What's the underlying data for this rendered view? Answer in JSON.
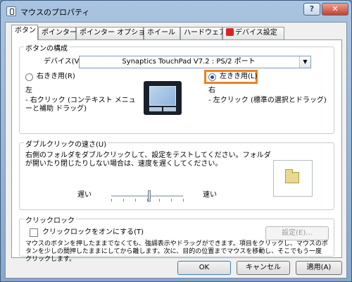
{
  "window": {
    "title": "マウスのプロパティ",
    "help_label": "?",
    "close_label": "✕"
  },
  "tabs": [
    {
      "label": "ボタン",
      "active": true
    },
    {
      "label": "ポインター",
      "active": false
    },
    {
      "label": "ポインター オプション",
      "active": false
    },
    {
      "label": "ホイール",
      "active": false
    },
    {
      "label": "ハードウェア",
      "active": false
    },
    {
      "label": "デバイス設定",
      "active": false,
      "icon": "device-settings-icon"
    }
  ],
  "button_config": {
    "group_title": "ボタンの構成",
    "device_label": "デバイス(V):",
    "device_value": "Synaptics TouchPad V7.2 : PS/2 ポート",
    "right_handed_label": "右きき用(R)",
    "left_handed_label": "左きき用(L)",
    "selected": "left_handed",
    "left_side": {
      "title": "左",
      "desc": "- 右クリック (コンテキスト メニューと補助 ドラッグ)"
    },
    "right_side": {
      "title": "右",
      "desc": "- 左クリック (標準の選択とドラッグ)"
    }
  },
  "double_click": {
    "group_title": "ダブルクリックの速さ(U)",
    "desc": "右側のフォルダをダブルクリックして、設定をテストしてください。フォルダが開いたり閉じたりしない場合は、速度を遅くしてください。",
    "slow_label": "遅い",
    "fast_label": "速い",
    "speed": 0.5
  },
  "click_lock": {
    "group_title": "クリックロック",
    "checkbox_label": "クリックロックをオンにする(T)",
    "checked": false,
    "settings_label": "設定(E)...",
    "desc": "マウスのボタンを押したままでなくても、強調表示やドラッグができます。項目をクリックし、マウスのボタンを少しの間押したままにしてから離します。次に、目的の位置までマウスを移動し、そこでもう一度クリックします。"
  },
  "footer": {
    "ok_label": "OK",
    "cancel_label": "キャンセル",
    "apply_label": "適用(A)"
  },
  "colors": {
    "highlight": "#f08020",
    "title_bar": "#a9c4e0"
  }
}
